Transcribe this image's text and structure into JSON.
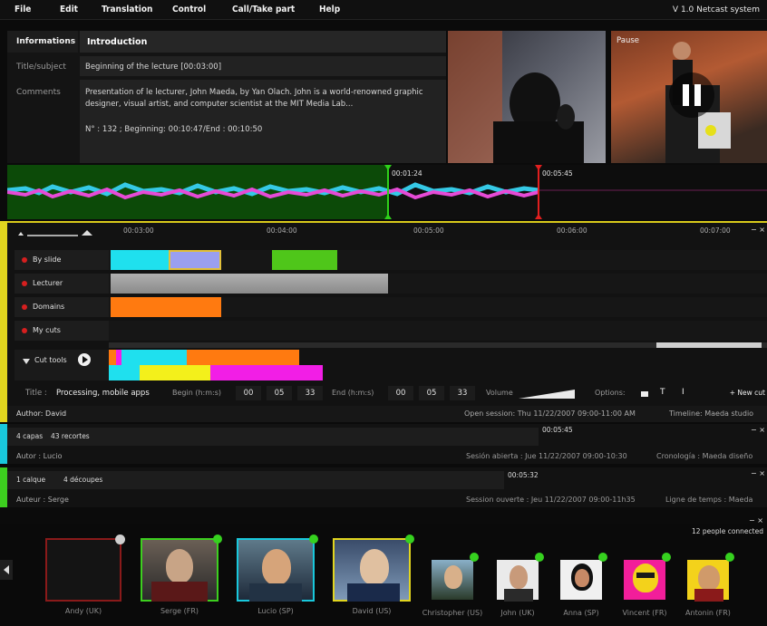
{
  "menu": {
    "items": [
      "File",
      "Edit",
      "Translation",
      "Control",
      "Call/Take part",
      "Help"
    ],
    "version": "V 1.0 Netcast system"
  },
  "info": {
    "header_label": "Informations",
    "header_value": "Introduction",
    "title_label": "Title/subject",
    "title_value": "Beginning of the lecture [00:03:00]",
    "comments_label": "Comments",
    "comments_value": "Presentation of le lecturer, John Maeda, by Yan Olach. John is a world-renowned graphic designer, visual artist, and computer scientist at the MIT Media Lab...",
    "timing": "N° : 132 ; Beginning: 00:10:47/End : 00:10:50"
  },
  "video": {
    "pause_label": "Pause"
  },
  "waveform": {
    "marker_left": "00:01:24",
    "marker_right": "00:05:45"
  },
  "timeline": {
    "ticks": [
      "00:03:00",
      "00:04:00",
      "00:05:00",
      "00:06:00",
      "00:07:00"
    ],
    "tracks": [
      "By slide",
      "Lecturer",
      "Domains",
      "My cuts"
    ],
    "cut_tools_label": "Cut tools",
    "close": "− ×",
    "colors": {
      "cyan": "#1fe0ee",
      "lavender": "#9a9ff0",
      "green": "#4fc61a",
      "gray": "#9a9a9a",
      "orange": "#ff7a10",
      "yellow": "#f3f01b",
      "magenta": "#f21ee6",
      "accent": "#e1d51f"
    }
  },
  "cut_form": {
    "title_label": "Title :",
    "title_value": "Processing, mobile apps",
    "begin_label": "Begin (h:m:s)",
    "begin": [
      "00",
      "05",
      "33"
    ],
    "end_label": "End (h:m:s)",
    "end": [
      "00",
      "05",
      "33"
    ],
    "volume_label": "Volume",
    "options_label": "Options:",
    "new_cut": "+ New cut"
  },
  "session_main": {
    "author": "Author: David",
    "open": "Open session: Thu 11/22/2007 09:00-11:00 AM",
    "timeline": "Timeline: Maeda studio"
  },
  "session_es": {
    "layers": "4 capas",
    "cuts": "43 recortes",
    "time": "00:05:45",
    "author": "Autor : Lucio",
    "open": "Sesión abierta : Jue 11/22/2007 09:00-10:30",
    "timeline": "Cronología : Maeda diseño",
    "close": "− ×",
    "color": "#19c8dc"
  },
  "session_fr": {
    "layers": "1 calque",
    "cuts": "4 découpes",
    "time": "00:05:32",
    "author": "Auteur : Serge",
    "open": "Session ouverte : Jeu 11/22/2007 09:00-11h35",
    "timeline": "Ligne de temps : Maeda",
    "close": "− ×",
    "color": "#3dcf1f"
  },
  "people": {
    "connected": "12 people connected",
    "list": [
      "Andy (UK)",
      "Serge (FR)",
      "Lucio (SP)",
      "David (US)",
      "Christopher (US)",
      "John (UK)",
      "Anna (SP)",
      "Vincent (FR)",
      "Antonin (FR)"
    ],
    "close": "− ×"
  }
}
